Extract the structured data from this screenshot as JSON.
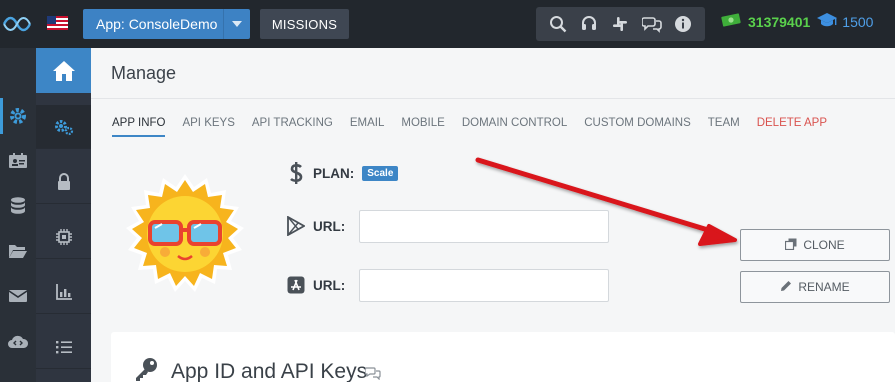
{
  "topbar": {
    "app_selector_label": "App: ConsoleDemo",
    "missions_label": "MISSIONS",
    "coins_value": "31379401",
    "grad_value": "1500",
    "tool_icons": [
      "search-icon",
      "headset-icon",
      "slack-icon",
      "chat-icon",
      "info-icon"
    ]
  },
  "page": {
    "title": "Manage"
  },
  "tabs": [
    {
      "label": "APP INFO"
    },
    {
      "label": "API KEYS"
    },
    {
      "label": "API TRACKING"
    },
    {
      "label": "EMAIL"
    },
    {
      "label": "MOBILE"
    },
    {
      "label": "DOMAIN CONTROL"
    },
    {
      "label": "CUSTOM DOMAINS"
    },
    {
      "label": "TEAM"
    },
    {
      "label": "DELETE APP"
    }
  ],
  "app_info": {
    "plan_label": "PLAN:",
    "plan_value": "Scale",
    "play_url_label": "URL:",
    "play_url_value": "",
    "appstore_url_label": "URL:",
    "appstore_url_value": ""
  },
  "actions": {
    "clone_label": "CLONE",
    "rename_label": "RENAME"
  },
  "section": {
    "title": "App ID and API Keys"
  },
  "colors": {
    "topbar_bg": "#22272d",
    "accent_blue": "#3d86c6",
    "coins_green": "#5ad14c",
    "danger_red": "#d9534f",
    "annotation_arrow": "#d9141a"
  }
}
